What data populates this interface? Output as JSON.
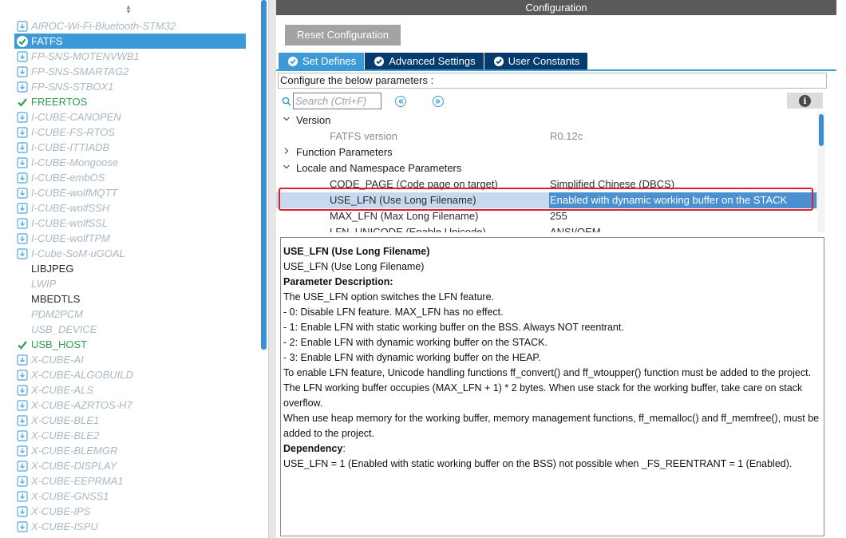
{
  "components": [
    {
      "label": "AIROC-Wi-Fi-Bluetooth-STM32",
      "state": "pack"
    },
    {
      "label": "FATFS",
      "state": "selected"
    },
    {
      "label": "FP-SNS-MOTENVWB1",
      "state": "pack"
    },
    {
      "label": "FP-SNS-SMARTAG2",
      "state": "pack"
    },
    {
      "label": "FP-SNS-STBOX1",
      "state": "pack"
    },
    {
      "label": "FREERTOS",
      "state": "on"
    },
    {
      "label": "I-CUBE-CANOPEN",
      "state": "pack"
    },
    {
      "label": "I-CUBE-FS-RTOS",
      "state": "pack"
    },
    {
      "label": "I-CUBE-ITTIADB",
      "state": "pack"
    },
    {
      "label": "I-CUBE-Mongoose",
      "state": "pack"
    },
    {
      "label": "I-CUBE-embOS",
      "state": "pack"
    },
    {
      "label": "I-CUBE-wolfMQTT",
      "state": "pack"
    },
    {
      "label": "I-CUBE-wolfSSH",
      "state": "pack"
    },
    {
      "label": "I-CUBE-wolfSSL",
      "state": "pack"
    },
    {
      "label": "I-CUBE-wolfTPM",
      "state": "pack"
    },
    {
      "label": "I-Cube-SoM-uGOAL",
      "state": "pack"
    },
    {
      "label": "LIBJPEG",
      "state": "plain"
    },
    {
      "label": "LWIP",
      "state": "dim"
    },
    {
      "label": "MBEDTLS",
      "state": "plain"
    },
    {
      "label": "PDM2PCM",
      "state": "dim"
    },
    {
      "label": "USB_DEVICE",
      "state": "dim"
    },
    {
      "label": "USB_HOST",
      "state": "on"
    },
    {
      "label": "X-CUBE-AI",
      "state": "pack"
    },
    {
      "label": "X-CUBE-ALGOBUILD",
      "state": "pack"
    },
    {
      "label": "X-CUBE-ALS",
      "state": "pack"
    },
    {
      "label": "X-CUBE-AZRTOS-H7",
      "state": "pack"
    },
    {
      "label": "X-CUBE-BLE1",
      "state": "pack"
    },
    {
      "label": "X-CUBE-BLE2",
      "state": "pack"
    },
    {
      "label": "X-CUBE-BLEMGR",
      "state": "pack"
    },
    {
      "label": "X-CUBE-DISPLAY",
      "state": "pack"
    },
    {
      "label": "X-CUBE-EEPRMA1",
      "state": "pack"
    },
    {
      "label": "X-CUBE-GNSS1",
      "state": "pack"
    },
    {
      "label": "X-CUBE-IPS",
      "state": "pack"
    },
    {
      "label": "X-CUBE-ISPU",
      "state": "pack"
    }
  ],
  "config": {
    "header": "Configuration",
    "reset_label": "Reset Configuration",
    "tabs": [
      "Set Defines",
      "Advanced Settings",
      "User Constants"
    ],
    "configure_label": "Configure the below parameters :",
    "search_placeholder": "Search (Ctrl+F)"
  },
  "tree": [
    {
      "type": "group",
      "name": "Version",
      "expanded": true
    },
    {
      "type": "param",
      "name": "FATFS version",
      "value": "R0.12c",
      "readonly": true
    },
    {
      "type": "group",
      "name": "Function Parameters",
      "expanded": false
    },
    {
      "type": "group",
      "name": "Locale and Namespace Parameters",
      "expanded": true
    },
    {
      "type": "param",
      "name": "CODE_PAGE (Code page on target)",
      "value": "Simplified Chinese (DBCS)"
    },
    {
      "type": "param",
      "name": "USE_LFN (Use Long Filename)",
      "value": "Enabled with dynamic working buffer on the STACK",
      "selected": true
    },
    {
      "type": "param",
      "name": "MAX_LFN (Max Long Filename)",
      "value": "255"
    },
    {
      "type": "param",
      "name": "LFN_UNICODE (Enable Unicode)",
      "value": "ANSI/OEM"
    }
  ],
  "description": {
    "title": "USE_LFN (Use Long Filename)",
    "subtitle": "USE_LFN (Use Long Filename)",
    "param_heading": "Parameter Description:",
    "lines": [
      "The USE_LFN option switches the LFN feature.",
      "- 0: Disable LFN feature. MAX_LFN has no effect.",
      "- 1: Enable LFN with static working buffer on the BSS. Always NOT reentrant.",
      "- 2: Enable LFN with dynamic working buffer on the STACK.",
      "- 3: Enable LFN with dynamic working buffer on the HEAP.",
      "To enable LFN feature, Unicode handling functions ff_convert() and ff_wtoupper() function must be added to the project.",
      "The LFN working buffer occupies (MAX_LFN + 1) * 2 bytes. When use stack for the working buffer, take care on stack overflow.",
      "When use heap memory for the working buffer, memory management functions, ff_memalloc() and ff_memfree(), must be added to the project."
    ],
    "dependency_heading": "Dependency",
    "dependency_colon": ":",
    "dependency_text": "USE_LFN = 1 (Enabled with static working buffer on the BSS) not possible when _FS_REENTRANT = 1 (Enabled)."
  },
  "colors": {
    "accent_blue": "#3c9ad6",
    "tab_dark": "#063b6e",
    "enabled_green": "#2e9c4f",
    "highlight_red": "#e0202a"
  }
}
